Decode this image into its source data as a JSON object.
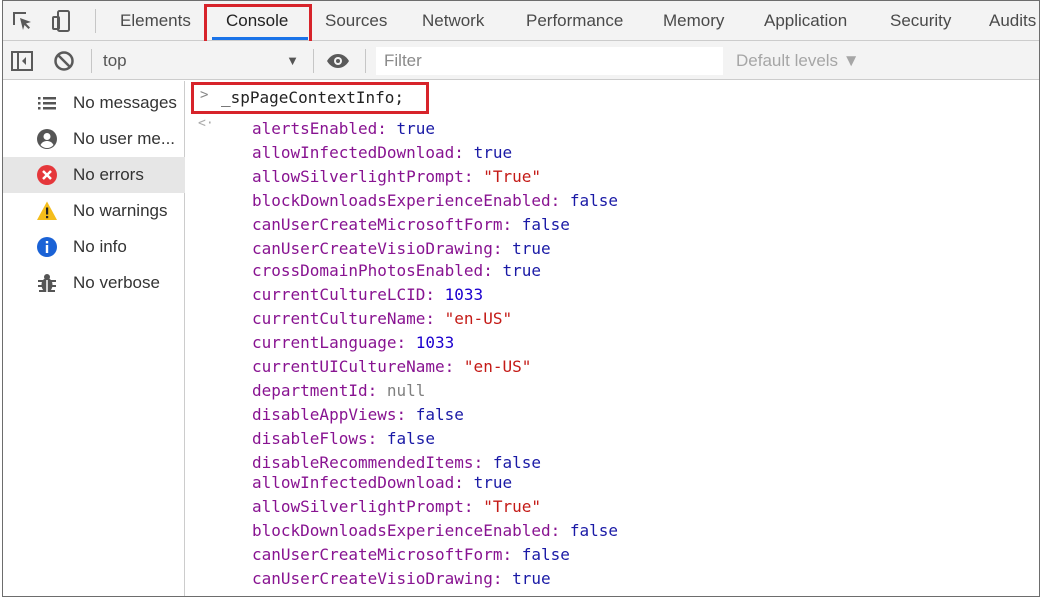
{
  "tabs": [
    {
      "label": "Elements"
    },
    {
      "label": "Console"
    },
    {
      "label": "Sources"
    },
    {
      "label": "Network"
    },
    {
      "label": "Performance"
    },
    {
      "label": "Memory"
    },
    {
      "label": "Application"
    },
    {
      "label": "Security"
    },
    {
      "label": "Audits"
    }
  ],
  "active_tab": "Console",
  "toolbar": {
    "context": "top",
    "filter_placeholder": "Filter",
    "levels": "Default levels ▼"
  },
  "sidebar": {
    "items": [
      {
        "label": "No messages",
        "icon": "list-icon"
      },
      {
        "label": "No user me...",
        "icon": "user-icon"
      },
      {
        "label": "No errors",
        "icon": "error-icon"
      },
      {
        "label": "No warnings",
        "icon": "warning-icon"
      },
      {
        "label": "No info",
        "icon": "info-icon"
      },
      {
        "label": "No verbose",
        "icon": "bug-icon"
      }
    ],
    "selected": "No errors"
  },
  "console": {
    "command": "_spPageContextInfo;",
    "properties": [
      {
        "key": "alertsEnabled",
        "value": "true",
        "type": "bool"
      },
      {
        "key": "allowInfectedDownload",
        "value": "true",
        "type": "bool"
      },
      {
        "key": "allowSilverlightPrompt",
        "value": "\"True\"",
        "type": "str"
      },
      {
        "key": "blockDownloadsExperienceEnabled",
        "value": "false",
        "type": "bool"
      },
      {
        "key": "canUserCreateMicrosoftForm",
        "value": "false",
        "type": "bool"
      },
      {
        "key": "canUserCreateVisioDrawing",
        "value": "true",
        "type": "bool"
      },
      {
        "key": "crossDomainPhotosEnabled",
        "value": "true",
        "type": "bool"
      },
      {
        "key": "currentCultureLCID",
        "value": "1033",
        "type": "num"
      },
      {
        "key": "currentCultureName",
        "value": "\"en-US\"",
        "type": "str"
      },
      {
        "key": "currentLanguage",
        "value": "1033",
        "type": "num"
      },
      {
        "key": "currentUICultureName",
        "value": "\"en-US\"",
        "type": "str"
      },
      {
        "key": "departmentId",
        "value": "null",
        "type": "null"
      },
      {
        "key": "disableAppViews",
        "value": "false",
        "type": "bool"
      },
      {
        "key": "disableFlows",
        "value": "false",
        "type": "bool"
      },
      {
        "key": "disableRecommendedItems",
        "value": "false",
        "type": "bool"
      },
      {
        "key": "allowInfectedDownload",
        "value": "true",
        "type": "bool"
      },
      {
        "key": "allowSilverlightPrompt",
        "value": "\"True\"",
        "type": "str"
      },
      {
        "key": "blockDownloadsExperienceEnabled",
        "value": "false",
        "type": "bool"
      },
      {
        "key": "canUserCreateMicrosoftForm",
        "value": "false",
        "type": "bool"
      },
      {
        "key": "canUserCreateVisioDrawing",
        "value": "true",
        "type": "bool"
      }
    ]
  },
  "colors": {
    "highlight_box": "#d7232a",
    "active_tab_underline": "#1a73e8",
    "property_key": "#881391",
    "value_bool": "#1a1aa6",
    "value_number": "#1c00cf",
    "value_string": "#c41a16",
    "value_null": "#808080"
  }
}
